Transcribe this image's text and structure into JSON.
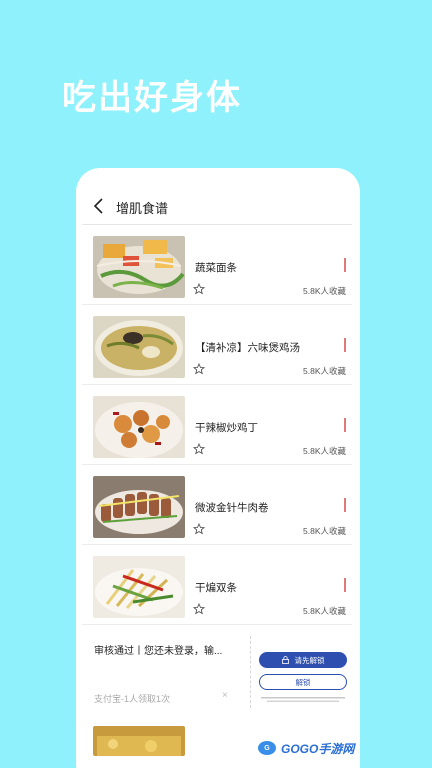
{
  "headline": "吃出好身体",
  "header": {
    "title": "增肌食谱"
  },
  "recipes": [
    {
      "title": "蔬菜面条",
      "count": "5.8K人收藏"
    },
    {
      "title": "【清补凉】六味煲鸡汤",
      "count": "5.8K人收藏"
    },
    {
      "title": "干辣椒炒鸡丁",
      "count": "5.8K人收藏"
    },
    {
      "title": "微波金针牛肉卷",
      "count": "5.8K人收藏"
    },
    {
      "title": "干煸双条",
      "count": "5.8K人收藏"
    }
  ],
  "ad": {
    "text": "审核通过丨您还未登录，输...",
    "source": "支付宝-1人领取1次",
    "close": "×",
    "primary_button": "请先解锁",
    "secondary_button": "解锁"
  },
  "watermark": {
    "text": "GOGO手游网"
  },
  "colors": {
    "background": "#8ff1fb",
    "accent": "#e07a7a",
    "button": "#2e4fb0"
  }
}
